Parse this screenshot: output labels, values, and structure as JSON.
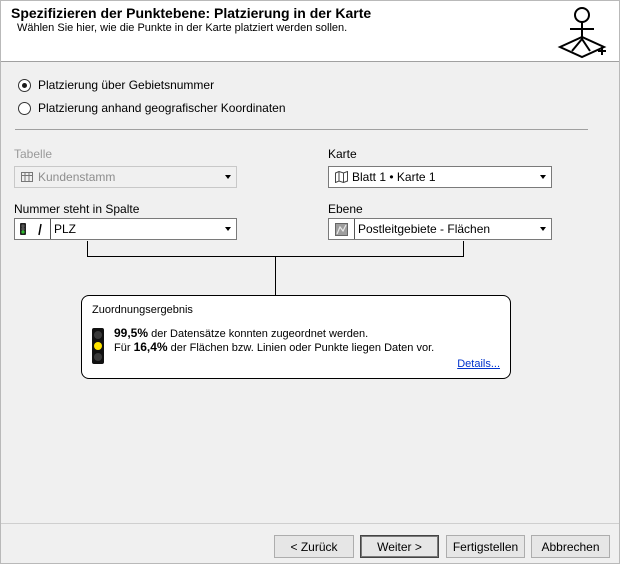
{
  "header": {
    "title": "Spezifizieren der Punktebene: Platzierung in der Karte",
    "subtitle": "Wählen Sie hier, wie die Punkte in der Karte platziert werden sollen."
  },
  "placement": {
    "option_area_number": "Platzierung über Gebietsnummer",
    "option_geo_coords": "Platzierung anhand geografischer Koordinaten",
    "selected": "option_area_number"
  },
  "fields": {
    "table_label": "Tabelle",
    "table_value": "Kundenstamm",
    "map_label": "Karte",
    "map_value": "Blatt 1 • Karte 1",
    "column_label": "Nummer steht in Spalte",
    "column_value": "PLZ",
    "layer_label": "Ebene",
    "layer_value": "Postleitgebiete - Flächen"
  },
  "result": {
    "title": "Zuordnungsergebnis",
    "line1_value": "99,5%",
    "line1_text": " der Datensätze konnten zugeordnet werden.",
    "line2_prefix": "Für ",
    "line2_value": "16,4%",
    "line2_text": " der Flächen bzw. Linien oder Punkte liegen Daten vor.",
    "details_link": "Details...",
    "traffic_light_state": "yellow"
  },
  "buttons": {
    "back": "< Zurück",
    "next": "Weiter >",
    "finish": "Fertigstellen",
    "cancel": "Abbrechen"
  },
  "colors": {
    "traffic_light_on": "#ffe400",
    "link": "#0033cc"
  }
}
